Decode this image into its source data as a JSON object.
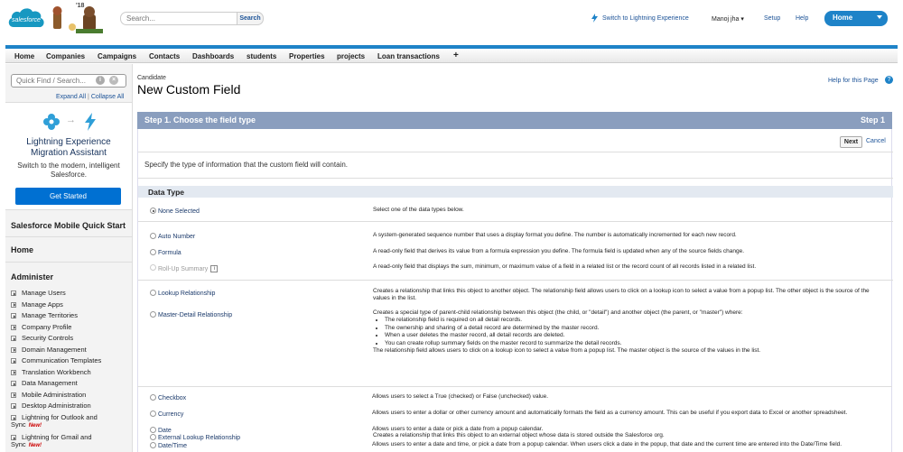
{
  "brand": {
    "logo_text": "salesforce",
    "year_badge": "'18"
  },
  "search": {
    "placeholder": "Search...",
    "button": "Search"
  },
  "top_links": {
    "lightning": "Switch to Lightning Experience",
    "user": "Manoj jha",
    "setup": "Setup",
    "help": "Help"
  },
  "app_menu": {
    "label": "Home"
  },
  "tabs": [
    "Home",
    "Companies",
    "Campaigns",
    "Contacts",
    "Dashboards",
    "students",
    "Properties",
    "projects",
    "Loan transactions",
    "+"
  ],
  "sidebar": {
    "quick_find_placeholder": "Quick Find / Search...",
    "expand_all": "Expand All",
    "collapse_all": "Collapse All",
    "separator": "|",
    "promo": {
      "title_line1": "Lightning Experience",
      "title_line2": "Migration Assistant",
      "body_line1": "Switch to the modern, intelligent",
      "body_line2": "Salesforce.",
      "button": "Get Started"
    },
    "mobile_heading": "Salesforce Mobile Quick Start",
    "home_heading": "Home",
    "administer_heading": "Administer",
    "items": [
      {
        "label": "Manage Users"
      },
      {
        "label": "Manage Apps"
      },
      {
        "label": "Manage Territories"
      },
      {
        "label": "Company Profile"
      },
      {
        "label": "Security Controls"
      },
      {
        "label": "Domain Management"
      },
      {
        "label": "Communication Templates"
      },
      {
        "label": "Translation Workbench"
      },
      {
        "label": "Data Management"
      },
      {
        "label": "Mobile Administration"
      },
      {
        "label": "Desktop Administration"
      },
      {
        "label": "Lightning for Outlook and",
        "label2": "Sync",
        "badge": "New!"
      },
      {
        "label": "Lightning for Gmail and",
        "label2": "Sync",
        "badge": "New!"
      }
    ]
  },
  "page": {
    "breadcrumb": "Candidate",
    "title": "New Custom Field",
    "help_link": "Help for this Page",
    "step_title": "Step 1. Choose the field type",
    "step_number": "Step 1",
    "next_button": "Next",
    "cancel_link": "Cancel",
    "description": "Specify the type of information that the custom field will contain.",
    "data_type_heading": "Data Type"
  },
  "data_types": [
    {
      "label": "None Selected",
      "selected": true,
      "disabled": false,
      "desc": "Select one of the data types below."
    },
    {
      "label": "Auto Number",
      "selected": false,
      "disabled": false,
      "desc": "A system-generated sequence number that uses a display format you define. The number is automatically incremented for each new record."
    },
    {
      "label": "Formula",
      "selected": false,
      "disabled": false,
      "desc": "A read-only field that derives its value from a formula expression you define. The formula field is updated when any of the source fields change."
    },
    {
      "label": "Roll-Up Summary",
      "selected": false,
      "disabled": true,
      "info": "i",
      "desc": "A read-only field that displays the sum, minimum, or maximum value of a field in a related list or the record count of all records listed in a related list."
    },
    {
      "label": "Lookup Relationship",
      "selected": false,
      "disabled": false,
      "desc": "Creates a relationship that links this object to another object. The relationship field allows users to click on a lookup icon to select a value from a popup list. The other object is the source of the values in the list."
    },
    {
      "label": "Master-Detail Relationship",
      "selected": false,
      "disabled": false,
      "desc": "Creates a special type of parent-child relationship between this object (the child, or \"detail\") and another object (the parent, or \"master\") where:",
      "bullets": [
        "The relationship field is required on all detail records.",
        "The ownership and sharing of a detail record are determined by the master record.",
        "When a user deletes the master record, all detail records are deleted.",
        "You can create rollup summary fields on the master record to summarize the detail records."
      ],
      "desc2": "The relationship field allows users to click on a lookup icon to select a value from a popup list. The master object is the source of the values in the list."
    },
    {
      "label": "External Lookup Relationship",
      "selected": false,
      "disabled": false,
      "desc": "Creates a relationship that links this object to an external object whose data is stored outside the Salesforce org."
    },
    {
      "label": "Checkbox",
      "selected": false,
      "disabled": false,
      "desc": "Allows users to select a True (checked) or False (unchecked) value."
    },
    {
      "label": "Currency",
      "selected": false,
      "disabled": false,
      "desc": "Allows users to enter a dollar or other currency amount and automatically formats the field as a currency amount. This can be useful if you export data to Excel or another spreadsheet."
    },
    {
      "label": "Date",
      "selected": false,
      "disabled": false,
      "desc": "Allows users to enter a date or pick a date from a popup calendar."
    },
    {
      "label": "Date/Time",
      "selected": false,
      "disabled": false,
      "desc": "Allows users to enter a date and time, or pick a date from a popup calendar. When users click a date in the popup, that date and the current time are entered into the Date/Time field."
    }
  ],
  "colors": {
    "brand_blue": "#1e83c8",
    "step_bar": "#8a9ebe",
    "link": "#1b5297"
  }
}
